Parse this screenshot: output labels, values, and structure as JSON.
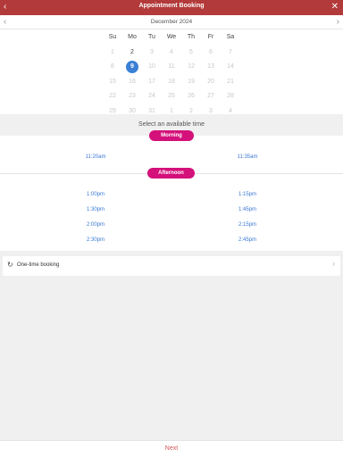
{
  "header": {
    "title": "Appointment Booking",
    "back_icon": "‹",
    "close_icon": "✕"
  },
  "calendar": {
    "month_label": "December 2024",
    "prev_icon": "‹",
    "next_icon": "›",
    "weekdays": [
      "Su",
      "Mo",
      "Tu",
      "We",
      "Th",
      "Fr",
      "Sa"
    ],
    "weeks": [
      [
        "1",
        "2",
        "3",
        "4",
        "5",
        "6",
        "7"
      ],
      [
        "8",
        "9",
        "10",
        "11",
        "12",
        "13",
        "14"
      ],
      [
        "15",
        "16",
        "17",
        "18",
        "19",
        "20",
        "21"
      ],
      [
        "22",
        "23",
        "24",
        "25",
        "26",
        "27",
        "28"
      ],
      [
        "29",
        "30",
        "31",
        "1",
        "2",
        "3",
        "4"
      ]
    ],
    "selected_day": "9",
    "available_days": [
      "2"
    ],
    "selected_color": "#3a80d6"
  },
  "availability": {
    "title": "Select an available time",
    "morning_label": "Morning",
    "afternoon_label": "Afternoon",
    "morning_slots": [
      "11:20am",
      "11:35am"
    ],
    "afternoon_slots": [
      "1:00pm",
      "1:15pm",
      "1:30pm",
      "1:45pm",
      "2:00pm",
      "2:15pm",
      "2:30pm",
      "2:45pm"
    ],
    "pill_color": "#d4107a",
    "slot_color": "#3a78d4"
  },
  "booking_type": {
    "label": "One-time booking",
    "icon": "refresh-icon",
    "chevron": "›"
  },
  "footer": {
    "next_label": "Next"
  },
  "colors": {
    "header_bg": "#b33a3a"
  }
}
